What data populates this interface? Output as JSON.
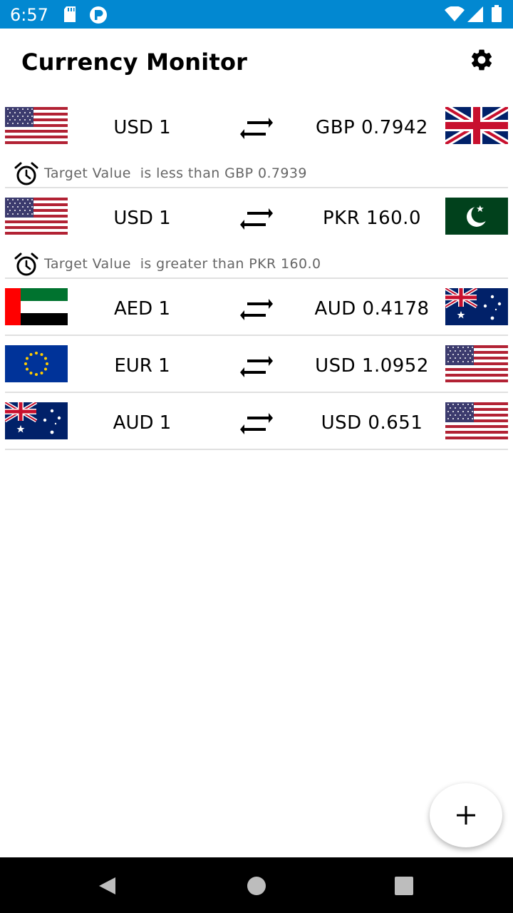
{
  "status_bar": {
    "time": "6:57",
    "background_color": "#0288d1",
    "icons": [
      "sd-card-icon",
      "notification-p-icon",
      "wifi-icon",
      "signal-icon",
      "battery-icon"
    ]
  },
  "app_bar": {
    "title": "Currency Monitor",
    "settings_icon": "gear-icon"
  },
  "pairs": [
    {
      "base_flag": "us-flag",
      "base_label": "USD 1",
      "quote_flag": "uk-flag",
      "quote_label": "GBP 0.7942",
      "alert": {
        "prefix": "Target Value",
        "text": "is less than GBP 0.7939"
      }
    },
    {
      "base_flag": "us-flag",
      "base_label": "USD 1",
      "quote_flag": "pakistan-flag",
      "quote_label": "PKR 160.0",
      "alert": {
        "prefix": "Target Value",
        "text": "is greater than PKR 160.0"
      }
    },
    {
      "base_flag": "uae-flag",
      "base_label": "AED 1",
      "quote_flag": "australia-flag",
      "quote_label": "AUD 0.4178"
    },
    {
      "base_flag": "eu-flag",
      "base_label": "EUR 1",
      "quote_flag": "us-flag",
      "quote_label": "USD 1.0952"
    },
    {
      "base_flag": "australia-flag",
      "base_label": "AUD 1",
      "quote_flag": "us-flag",
      "quote_label": "USD 0.651"
    }
  ],
  "fab": {
    "icon": "plus-icon"
  },
  "nav_bar": {
    "buttons": [
      "back-icon",
      "home-icon",
      "recents-icon"
    ]
  }
}
